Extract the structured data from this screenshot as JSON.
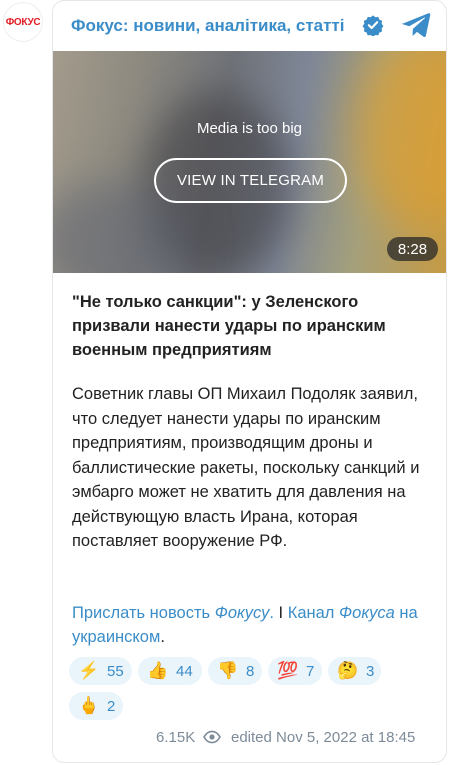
{
  "channel": {
    "avatar_text": "ФОКУС",
    "title": "Фокус: новини, аналітика, статті"
  },
  "media": {
    "message": "Media is too big",
    "button_label": "VIEW IN TELEGRAM",
    "duration": "8:28"
  },
  "post": {
    "headline": "\"Не только санкции\": у Зеленского призвали нанести удары по иранским военным предприятиям",
    "body": "Советник главы ОП Михаил Подоляк заявил, что следует нанести удары по иранским предприятиям, производящим дроны и баллистические ракеты, поскольку санкций и эмбарго может не хватить для давления на действующую власть Ирана, которая поставляет вооружение РФ.",
    "link1_a": "Прислать новость ",
    "link1_b": "Фокусу",
    "link1_c": ".",
    "separator": " I ",
    "link2_a": "Канал ",
    "link2_b": "Фокуса",
    "link2_c": " на украинском",
    "trailing": "."
  },
  "reactions": [
    {
      "emoji": "⚡",
      "count": "55"
    },
    {
      "emoji": "👍",
      "count": "44"
    },
    {
      "emoji": "👎",
      "count": "8"
    },
    {
      "emoji": "💯",
      "count": "7"
    },
    {
      "emoji": "🤔",
      "count": "3"
    },
    {
      "emoji": "🖕",
      "count": "2"
    }
  ],
  "footer": {
    "views": "6.15K",
    "edited": "edited  Nov 5, 2022 at 18:45"
  },
  "colors": {
    "accent": "#3a8dc8",
    "reaction_bg": "#eaf4fb",
    "brand_red": "#e31b23"
  }
}
